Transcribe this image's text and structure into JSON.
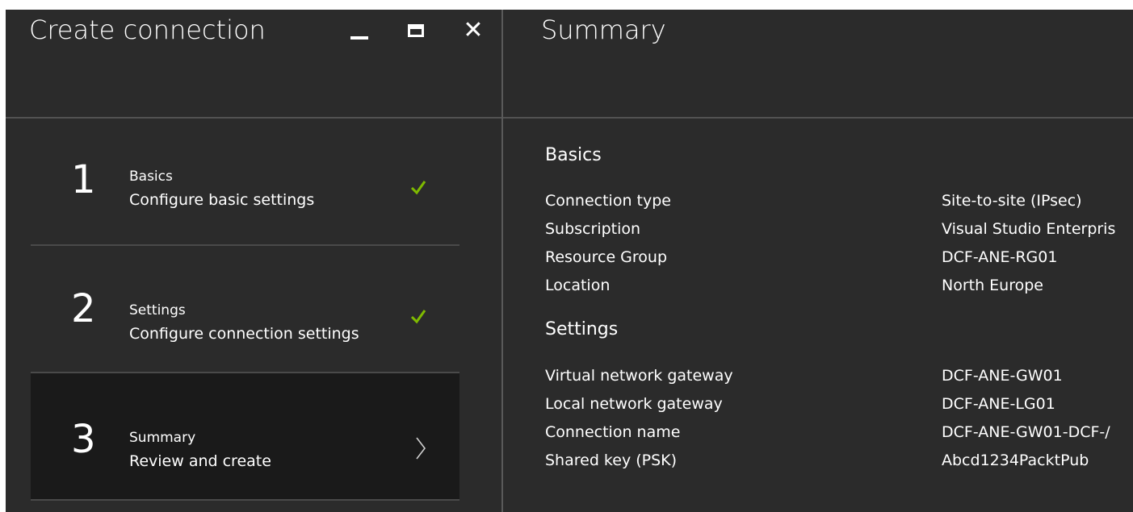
{
  "left_blade": {
    "title": "Create connection",
    "controls": [
      "minimize-icon",
      "maximize-icon",
      "close-icon"
    ],
    "close_glyph": "✕"
  },
  "steps": [
    {
      "number": "1",
      "title": "Basics",
      "subtitle": "Configure basic settings",
      "status": "complete",
      "icon": "check-icon"
    },
    {
      "number": "2",
      "title": "Settings",
      "subtitle": "Configure connection settings",
      "status": "complete",
      "icon": "check-icon"
    },
    {
      "number": "3",
      "title": "Summary",
      "subtitle": "Review and create",
      "status": "active",
      "icon": "chevron-right-icon"
    }
  ],
  "summary": {
    "title": "Summary",
    "basics": {
      "heading": "Basics",
      "rows": [
        {
          "label": "Connection type",
          "value": "Site-to-site (IPsec)"
        },
        {
          "label": "Subscription",
          "value": "Visual Studio Enterpris"
        },
        {
          "label": "Resource Group",
          "value": "DCF-ANE-RG01"
        },
        {
          "label": "Location",
          "value": "North Europe"
        }
      ]
    },
    "settings": {
      "heading": "Settings",
      "rows": [
        {
          "label": "Virtual network gateway",
          "value": "DCF-ANE-GW01"
        },
        {
          "label": "Local network gateway",
          "value": "DCF-ANE-LG01"
        },
        {
          "label": "Connection name",
          "value": "DCF-ANE-GW01-DCF-/"
        },
        {
          "label": "Shared key (PSK)",
          "value": "Abcd1234PacktPub"
        }
      ]
    }
  },
  "colors": {
    "background": "#2b2b2b",
    "active_step": "#1a1a1a",
    "check": "#7fba00",
    "text": "#ffffff",
    "divider": "#525252"
  }
}
